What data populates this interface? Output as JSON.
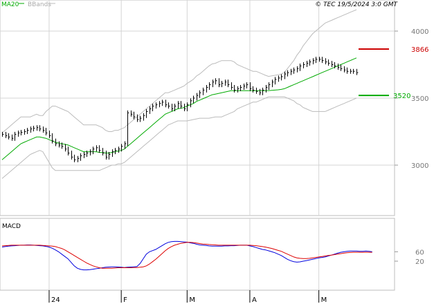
{
  "header": {
    "ma_label": "MA20",
    "bb_label": "BBands",
    "copyright": "© TEC 19/5/2024 3:0 GMT"
  },
  "colors": {
    "grid": "#d4d4d4",
    "price": "#000000",
    "ma": "#00aa00",
    "bbands": "#bbbbbb",
    "macd": "#0000dd",
    "signal": "#dd0000",
    "resistance": "#cc0000",
    "support": "#00aa00",
    "axis_text": "#777777"
  },
  "chart_data": [
    {
      "type": "ohlc",
      "title": "",
      "x_ticks": [
        {
          "label": "24",
          "index": 15
        },
        {
          "label": "F",
          "index": 38
        },
        {
          "label": "M",
          "index": 59
        },
        {
          "label": "A",
          "index": 79
        },
        {
          "label": "M",
          "index": 101
        }
      ],
      "y_ticks": [
        3000,
        3500,
        4000
      ],
      "ylim": [
        2650,
        4050
      ],
      "levels": [
        {
          "name": "resistance",
          "value": 3866,
          "label": "3866"
        },
        {
          "name": "support",
          "value": 3520,
          "label": "3520"
        }
      ],
      "series": [
        {
          "name": "price",
          "values": [
            3230,
            3220,
            3210,
            3200,
            3230,
            3240,
            3245,
            3250,
            3260,
            3270,
            3275,
            3280,
            3270,
            3260,
            3240,
            3220,
            3180,
            3160,
            3150,
            3140,
            3120,
            3090,
            3060,
            3040,
            3050,
            3070,
            3080,
            3090,
            3100,
            3120,
            3130,
            3110,
            3090,
            3060,
            3080,
            3100,
            3110,
            3120,
            3140,
            3160,
            3390,
            3380,
            3360,
            3340,
            3350,
            3370,
            3400,
            3420,
            3440,
            3450,
            3460,
            3470,
            3450,
            3440,
            3420,
            3440,
            3460,
            3440,
            3420,
            3450,
            3480,
            3500,
            3520,
            3540,
            3560,
            3580,
            3600,
            3620,
            3630,
            3600,
            3610,
            3620,
            3600,
            3580,
            3560,
            3570,
            3580,
            3590,
            3600,
            3570,
            3560,
            3550,
            3540,
            3560,
            3580,
            3600,
            3620,
            3640,
            3650,
            3660,
            3680,
            3690,
            3700,
            3710,
            3720,
            3740,
            3750,
            3760,
            3770,
            3780,
            3790,
            3790,
            3780,
            3770,
            3760,
            3750,
            3740,
            3730,
            3720,
            3710,
            3700,
            3700,
            3700,
            3690
          ]
        },
        {
          "name": "MA20",
          "values": [
            3040,
            3060,
            3080,
            3100,
            3120,
            3140,
            3160,
            3170,
            3180,
            3190,
            3200,
            3210,
            3210,
            3205,
            3200,
            3190,
            3180,
            3170,
            3165,
            3160,
            3155,
            3150,
            3140,
            3130,
            3120,
            3110,
            3100,
            3100,
            3100,
            3100,
            3100,
            3095,
            3095,
            3090,
            3090,
            3095,
            3100,
            3105,
            3110,
            3120,
            3140,
            3160,
            3180,
            3200,
            3220,
            3240,
            3260,
            3280,
            3300,
            3320,
            3340,
            3360,
            3380,
            3390,
            3400,
            3410,
            3420,
            3425,
            3430,
            3440,
            3450,
            3460,
            3475,
            3485,
            3495,
            3505,
            3515,
            3525,
            3530,
            3535,
            3540,
            3545,
            3550,
            3555,
            3555,
            3555,
            3555,
            3555,
            3555,
            3555,
            3555,
            3555,
            3555,
            3555,
            3555,
            3556,
            3558,
            3560,
            3562,
            3565,
            3570,
            3580,
            3590,
            3600,
            3610,
            3620,
            3630,
            3640,
            3650,
            3660,
            3670,
            3680,
            3690,
            3700,
            3710,
            3720,
            3730,
            3740,
            3750,
            3760,
            3770,
            3780,
            3790,
            3800
          ]
        },
        {
          "name": "BBands",
          "values": [
            2900,
            2920,
            2940,
            2960,
            2980,
            3000,
            3020,
            3040,
            3060,
            3080,
            3090,
            3100,
            3110,
            3100,
            3060,
            3020,
            2980,
            2960,
            2960,
            2960,
            2960,
            2960,
            2960,
            2960,
            2960,
            2960,
            2960,
            2960,
            2960,
            2960,
            2960,
            2960,
            2970,
            2980,
            2990,
            3000,
            3000,
            3010,
            3010,
            3020,
            3040,
            3060,
            3080,
            3100,
            3120,
            3140,
            3160,
            3180,
            3200,
            3220,
            3240,
            3260,
            3280,
            3300,
            3310,
            3320,
            3330,
            3330,
            3330,
            3330,
            3335,
            3340,
            3345,
            3350,
            3350,
            3350,
            3350,
            3355,
            3360,
            3360,
            3360,
            3370,
            3380,
            3390,
            3400,
            3420,
            3430,
            3440,
            3450,
            3460,
            3470,
            3470,
            3480,
            3490,
            3500,
            3510,
            3510,
            3510,
            3510,
            3510,
            3510,
            3500,
            3490,
            3480,
            3460,
            3450,
            3430,
            3420,
            3410,
            3400,
            3400,
            3400,
            3400,
            3400,
            3410,
            3420,
            3430,
            3440,
            3450,
            3460,
            3470,
            3480,
            3490,
            3500
          ]
        }
      ]
    },
    {
      "type": "line",
      "title": "MACD",
      "y_ticks": [
        {
          "label": "60",
          "value": 60
        },
        {
          "label": "20",
          "value": 20
        }
      ],
      "ylim": [
        -40,
        110
      ],
      "series": [
        {
          "name": "MACD",
          "values": [
            80,
            82,
            84,
            85,
            86,
            87,
            88,
            88,
            89,
            89,
            88,
            87,
            86,
            85,
            83,
            80,
            75,
            68,
            60,
            50,
            40,
            30,
            15,
            0,
            -10,
            -15,
            -17,
            -17,
            -16,
            -14,
            -12,
            -10,
            -8,
            -6,
            -5,
            -4,
            -4,
            -5,
            -6,
            -7,
            -6,
            -5,
            -4,
            -3,
            10,
            30,
            50,
            60,
            65,
            70,
            78,
            86,
            94,
            100,
            103,
            104,
            104,
            103,
            102,
            101,
            98,
            96,
            92,
            89,
            88,
            87,
            85,
            84,
            84,
            84,
            84,
            85,
            85,
            86,
            86,
            87,
            88,
            88,
            88,
            85,
            82,
            78,
            74,
            70,
            68,
            64,
            60,
            56,
            50,
            44,
            36,
            28,
            22,
            18,
            16,
            17,
            20,
            22,
            25,
            28,
            31,
            34,
            36,
            38,
            42,
            46,
            50,
            54,
            58,
            60,
            62,
            63,
            63,
            63,
            62,
            62,
            63,
            62,
            60
          ]
        },
        {
          "name": "Signal",
          "values": [
            85,
            86,
            87,
            88,
            88,
            88,
            88,
            88,
            88,
            88,
            88,
            88,
            88,
            87,
            86,
            85,
            84,
            82,
            78,
            74,
            68,
            60,
            52,
            44,
            36,
            28,
            20,
            12,
            6,
            0,
            -4,
            -8,
            -10,
            -10,
            -10,
            -10,
            -9,
            -8,
            -8,
            -8,
            -8,
            -8,
            -7,
            -7,
            -6,
            -4,
            0,
            8,
            18,
            28,
            40,
            52,
            64,
            74,
            82,
            88,
            92,
            96,
            98,
            100,
            100,
            99,
            97,
            95,
            93,
            92,
            91,
            90,
            89,
            88,
            88,
            88,
            88,
            88,
            88,
            88,
            88,
            88,
            88,
            88,
            87,
            86,
            84,
            82,
            80,
            77,
            74,
            70,
            66,
            62,
            56,
            50,
            44,
            38,
            34,
            32,
            31,
            31,
            32,
            34,
            36,
            38,
            40,
            42,
            44,
            46,
            48,
            50,
            52,
            54,
            56,
            57,
            58,
            58,
            58,
            58,
            58,
            58,
            58,
            58
          ]
        }
      ]
    }
  ]
}
